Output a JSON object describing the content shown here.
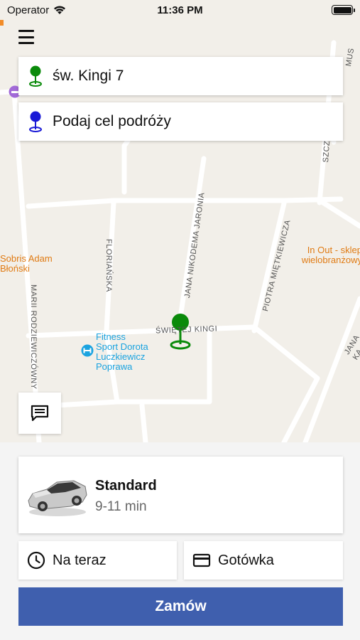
{
  "status_bar": {
    "carrier": "Operator",
    "time": "11:36 PM"
  },
  "pickup": {
    "address": "św. Kingi 7",
    "pin_color": "#0a8a0a"
  },
  "destination": {
    "placeholder": "Podaj cel podróży",
    "pin_color": "#1a1ad6"
  },
  "map": {
    "streets": [
      "MARII RODZIEWICZÓWNY",
      "FLORIAŃSKA",
      "JANA NIKODEMA JARONIA",
      "ŚWIĘTEJ KINGI",
      "PIOTRA MIĘTKIEWICZA",
      "JANA KA",
      "MUS",
      "SZCZ"
    ],
    "places": [
      {
        "name_lines": [
          "Sobris Adam",
          "Błoński"
        ],
        "color": "#e07b14"
      },
      {
        "name_lines": [
          "In Out - sklep",
          "wielobranżowy"
        ],
        "color": "#e07b14"
      },
      {
        "name_lines": [
          "Fitness",
          "Sport Dorota",
          "Luczkiewicz",
          "Poprawa"
        ],
        "color": "#1aa3e0"
      }
    ],
    "marker_color": "#0a8a0a"
  },
  "service": {
    "name": "Standard",
    "eta": "9-11 min"
  },
  "options": {
    "time_label": "Na teraz",
    "payment_label": "Gotówka"
  },
  "order_button": {
    "label": "Zamów",
    "color": "#3f5fae"
  }
}
